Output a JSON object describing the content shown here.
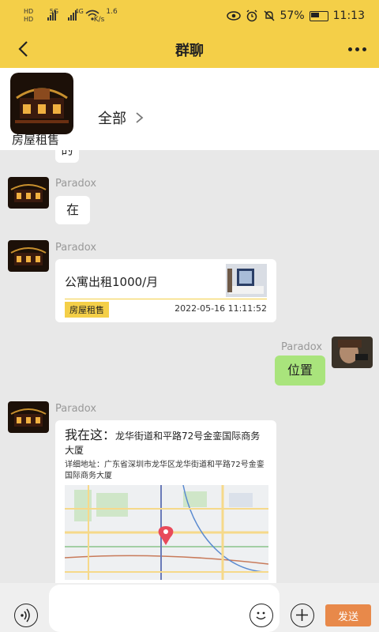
{
  "status_bar": {
    "hd1": "HD",
    "hd2": "HD",
    "net1": "5G",
    "net2": "4G",
    "speed_value": "1.6",
    "speed_unit": "K/s",
    "battery": "57%",
    "battery_level": 0.57,
    "time": "11:13"
  },
  "header": {
    "title": "群聊"
  },
  "group": {
    "name": "房屋租售",
    "all_label": "全部"
  },
  "messages": {
    "partial_text": "的",
    "m1": {
      "sender": "Paradox",
      "text": "在"
    },
    "m2": {
      "sender": "Paradox",
      "card_title": "公寓出租1000/月",
      "card_tag": "房屋租售",
      "card_time": "2022-05-16 11:11:52"
    },
    "m3": {
      "sender": "Paradox",
      "text": "位置"
    },
    "m4": {
      "sender": "Paradox",
      "loc_prefix": "我在这：",
      "loc_title": "龙华街道和平路72号金銮国际商务大厦",
      "loc_detail": "详细地址：广东省深圳市龙华区龙华街道和平路72号金銮国际商务大厦"
    }
  },
  "input": {
    "send_label": "发送"
  },
  "colors": {
    "accent": "#f4cf48",
    "send": "#e8894a",
    "my_bubble": "#a9e47c"
  }
}
